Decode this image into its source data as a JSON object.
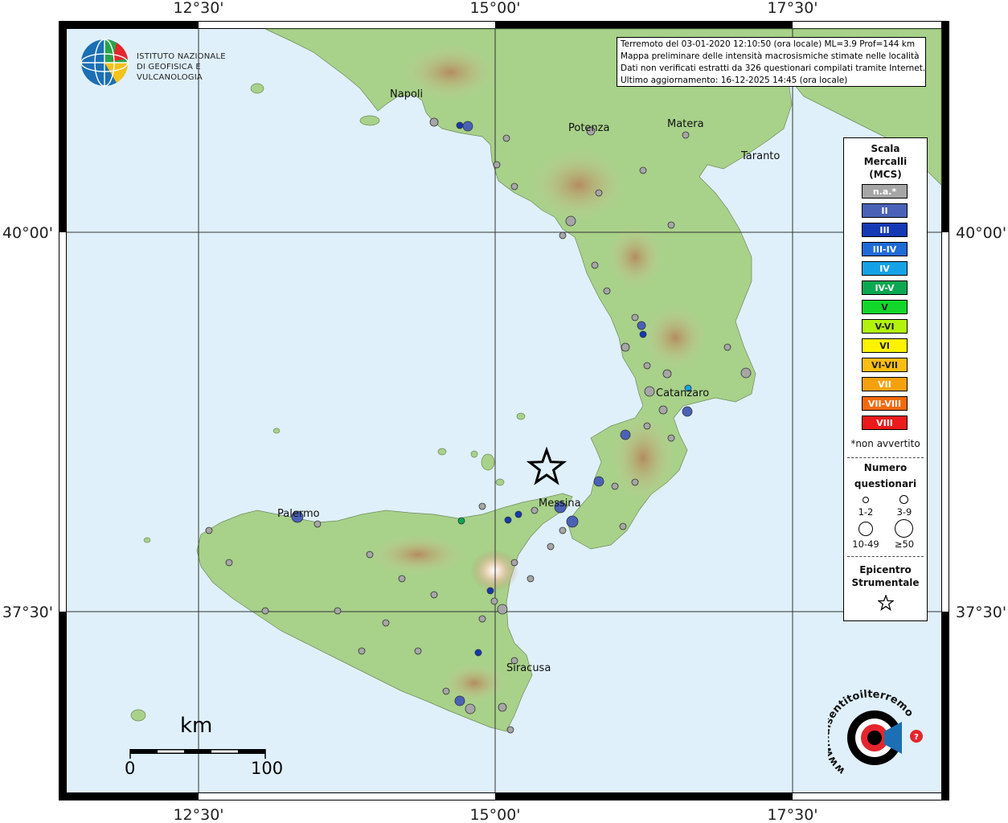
{
  "institution": {
    "line1": "ISTITUTO NAZIONALE",
    "line2": "DI GEOFISICA E VULCANOLOGIA",
    "logo_colors": [
      "#1c6fb3",
      "#2aa34a",
      "#e4262d",
      "#f4c21a"
    ]
  },
  "info": {
    "line1": "Terremoto del 03-01-2020 12:10:50 (ora locale) ML=3.9 Prof=144 km",
    "line2": "Mappa preliminare delle intensità macrosismiche stimate nelle località",
    "line3": "Dati non verificati estratti da 326 questionari compilati tramite Internet.",
    "line4": "Ultimo aggiornamento: 16-12-2025 14:45 (ora locale)"
  },
  "axes": {
    "top_ticks": [
      "12°30'",
      "15°00'",
      "17°30'"
    ],
    "bottom_ticks": [
      "12°30'",
      "15°00'",
      "17°30'"
    ],
    "left_ticks": [
      "40°00'",
      "37°30'"
    ],
    "right_ticks": [
      "40°00'",
      "37°30'"
    ]
  },
  "cities": [
    "Napoli",
    "Potenza",
    "Matera",
    "Taranto",
    "Catanzaro",
    "Palermo",
    "Messina",
    "Siracusa"
  ],
  "legend": {
    "title_line1": "Scala",
    "title_line2": "Mercalli",
    "title_line3": "(MCS)",
    "levels": [
      {
        "label": "n.a.*",
        "color": "#a6a6a6"
      },
      {
        "label": "II",
        "color": "#4a62b6"
      },
      {
        "label": "III",
        "color": "#1538b4"
      },
      {
        "label": "III-IV",
        "color": "#1f6ad6"
      },
      {
        "label": "IV",
        "color": "#14a2e6"
      },
      {
        "label": "IV-V",
        "color": "#0aa850"
      },
      {
        "label": "V",
        "color": "#12d62a"
      },
      {
        "label": "V-VI",
        "color": "#b3f20d"
      },
      {
        "label": "VI",
        "color": "#fdf300"
      },
      {
        "label": "VI-VII",
        "color": "#fbbd12"
      },
      {
        "label": "VII",
        "color": "#f5a10e"
      },
      {
        "label": "VII-VIII",
        "color": "#f26a0c"
      },
      {
        "label": "VIII",
        "color": "#ec1a1a"
      }
    ],
    "not_felt_note": "*non avvertito",
    "count_title_line1": "Numero",
    "count_title_line2": "questionari",
    "count_classes": [
      "1-2",
      "3-9",
      "10-49",
      "≥50"
    ],
    "epicenter_line1": "Epicentro",
    "epicenter_line2": "Strumentale"
  },
  "scalebar": {
    "unit": "km",
    "start": "0",
    "end": "100"
  },
  "watermark": {
    "text": "www.haisentitoilterremoto.it"
  },
  "colors": {
    "sea": "#dff0fb",
    "land_low": "#9fcf84",
    "land_mid": "#c9d59a",
    "land_high": "#b99566",
    "gridline": "#333333"
  }
}
